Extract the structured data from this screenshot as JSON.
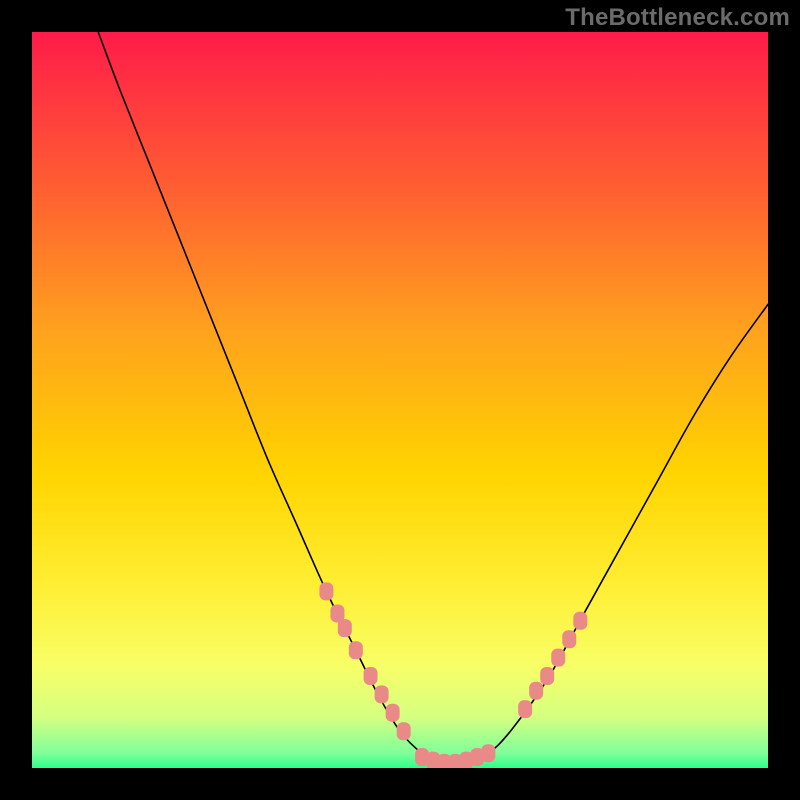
{
  "watermark": "TheBottleneck.com",
  "chart_data": {
    "type": "line",
    "title": "",
    "xlabel": "",
    "ylabel": "",
    "xlim": [
      0,
      100
    ],
    "ylim": [
      0,
      100
    ],
    "grid": false,
    "legend": false,
    "background_gradient": {
      "stops": [
        {
          "offset": 0.0,
          "color": "#ff1b4a"
        },
        {
          "offset": 0.2,
          "color": "#ff5a33"
        },
        {
          "offset": 0.4,
          "color": "#ffa01e"
        },
        {
          "offset": 0.6,
          "color": "#ffd400"
        },
        {
          "offset": 0.75,
          "color": "#ffee33"
        },
        {
          "offset": 0.86,
          "color": "#f8ff66"
        },
        {
          "offset": 0.93,
          "color": "#d6ff80"
        },
        {
          "offset": 0.98,
          "color": "#7fff9a"
        },
        {
          "offset": 1.0,
          "color": "#2dff8a"
        }
      ]
    },
    "series": [
      {
        "name": "curve",
        "color": "#000000",
        "width": 1.6,
        "x": [
          9,
          12,
          16,
          20,
          24,
          28,
          32,
          36,
          40,
          44,
          47,
          50,
          53,
          56,
          59,
          62,
          65,
          70,
          75,
          80,
          85,
          90,
          95,
          100
        ],
        "y": [
          100,
          92,
          82,
          72,
          62,
          52,
          42,
          33,
          24,
          16,
          10,
          5,
          2,
          0.5,
          0.5,
          2,
          5,
          12,
          21,
          30,
          39,
          48,
          56,
          63
        ]
      },
      {
        "name": "threshold-markers-left",
        "type": "scatter",
        "color": "#e98a88",
        "marker": "rounded-rect",
        "x": [
          40,
          41.5,
          42.5,
          44,
          46,
          47.5,
          49,
          50.5
        ],
        "y": [
          24,
          21,
          19,
          16,
          12.5,
          10,
          7.5,
          5
        ]
      },
      {
        "name": "threshold-markers-bottom",
        "type": "scatter",
        "color": "#e98a88",
        "marker": "rounded-rect",
        "x": [
          53,
          54.5,
          56,
          57.5,
          59,
          60.5,
          62
        ],
        "y": [
          1.5,
          1,
          0.7,
          0.7,
          1,
          1.5,
          2
        ]
      },
      {
        "name": "threshold-markers-right",
        "type": "scatter",
        "color": "#e98a88",
        "marker": "rounded-rect",
        "x": [
          67,
          68.5,
          70,
          71.5,
          73,
          74.5
        ],
        "y": [
          8,
          10.5,
          12.5,
          15,
          17.5,
          20
        ]
      }
    ]
  }
}
